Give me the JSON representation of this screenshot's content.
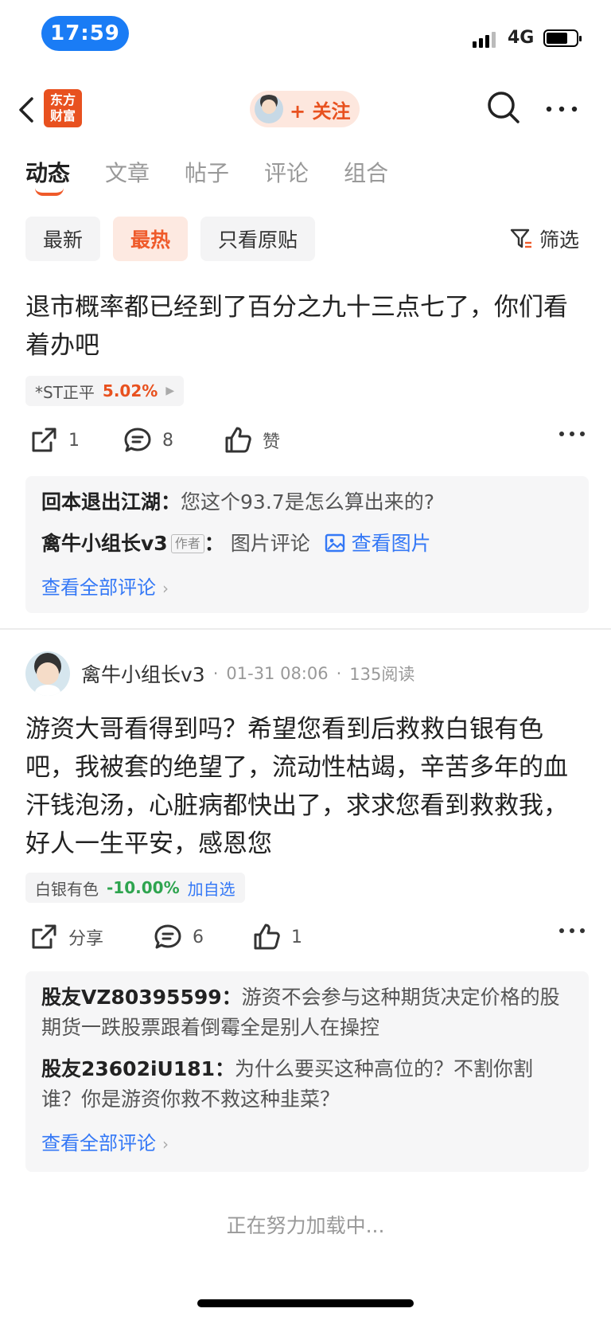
{
  "status": {
    "time": "17:59",
    "network": "4G"
  },
  "header": {
    "logo_text": "东方\n财富",
    "follow_label": "+ 关注"
  },
  "tabs": [
    {
      "label": "动态",
      "active": true
    },
    {
      "label": "文章",
      "active": false
    },
    {
      "label": "帖子",
      "active": false
    },
    {
      "label": "评论",
      "active": false
    },
    {
      "label": "组合",
      "active": false
    }
  ],
  "filters": {
    "chips": [
      {
        "label": "最新",
        "active": false
      },
      {
        "label": "最热",
        "active": true
      },
      {
        "label": "只看原贴",
        "active": false
      }
    ],
    "filter_label": "筛选"
  },
  "posts": [
    {
      "text": "退市概率都已经到了百分之九十三点七了，你们看着办吧",
      "stock": {
        "name": "*ST正平",
        "change": "5.02%"
      },
      "actions": {
        "share": "1",
        "comment": "8",
        "like": "赞"
      },
      "comments": [
        {
          "user": "回本退出江湖",
          "text": "您这个93.7是怎么算出来的?"
        },
        {
          "user": "禽牛小组长v3",
          "badge": "作者",
          "text": "图片评论",
          "link": "查看图片"
        }
      ],
      "view_all": "查看全部评论"
    },
    {
      "author": "禽牛小组长v3",
      "time": "01-31 08:06",
      "reads": "135阅读",
      "text": "游资大哥看得到吗？希望您看到后救救白银有色吧，我被套的绝望了，流动性枯竭，辛苦多年的血汗钱泡汤，心脏病都快出了，求求您看到救救我，好人一生平安，感恩您",
      "stock": {
        "name": "白银有色",
        "change": "-10.00%",
        "add": "加自选"
      },
      "actions": {
        "share": "分享",
        "comment": "6",
        "like": "1"
      },
      "comments": [
        {
          "user": "股友VZ80395599",
          "text": "游资不会参与这种期货决定价格的股期货一跌股票跟着倒霉全是别人在操控"
        },
        {
          "user": "股友23602iU181",
          "text": "为什么要买这种高位的？不割你割谁？你是游资你救不救这种韭菜？"
        }
      ],
      "view_all": "查看全部评论"
    }
  ],
  "loading": "正在努力加载中...",
  "colors": {
    "accent": "#ef5a2a",
    "link": "#3478f6",
    "up": "#e8511f",
    "down": "#2ea44f"
  }
}
